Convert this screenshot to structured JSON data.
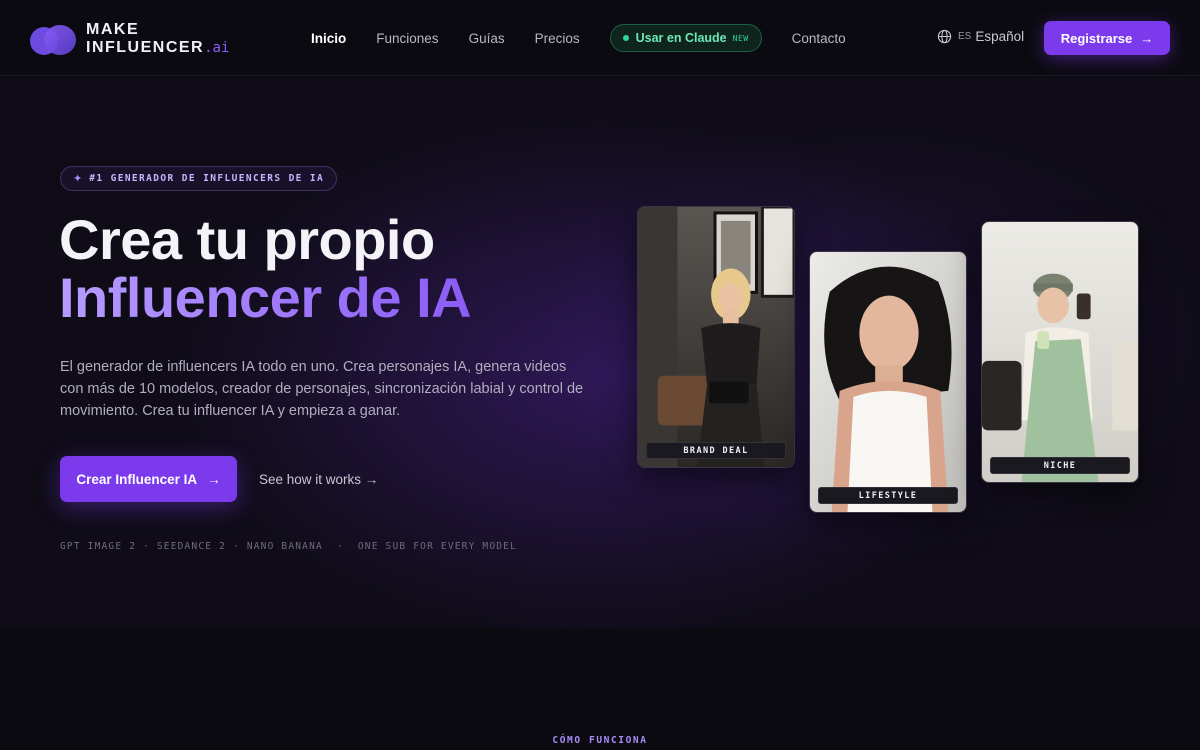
{
  "brand": {
    "line1": "MAKE",
    "line2": "INFLUENCER",
    "suffix": ".ai"
  },
  "nav": {
    "links": [
      "Inicio",
      "Funciones",
      "Guías",
      "Precios"
    ],
    "claude": {
      "label": "Usar en Claude",
      "badge": "NEW"
    },
    "contact": "Contacto",
    "lang_code": "ES",
    "lang_label": "Español",
    "register": "Registrarse"
  },
  "hero": {
    "badge": "#1 GENERADOR DE INFLUENCERS DE IA",
    "title_line1": "Crea tu propio",
    "title_line2": "Influencer de IA",
    "description": "El generador de influencers IA todo en uno. Crea personajes IA, genera videos con más de 10 modelos, creador de personajes, sincronización labial y control de movimiento. Crea tu influencer IA y empieza a ganar.",
    "cta_primary": "Crear Influencer IA",
    "cta_secondary": "See how it works →",
    "models_line": "GPT IMAGE 2 · SEEDANCE 2 · NANO BANANA",
    "models_tail": "ONE SUB FOR EVERY MODEL",
    "cards": [
      {
        "tag": "BRAND DEAL"
      },
      {
        "tag": "LIFESTYLE"
      },
      {
        "tag": "NICHE"
      }
    ]
  },
  "next_section": {
    "eyebrow": "CÓMO FUNCIONA"
  },
  "colors": {
    "accent": "#7c3aed",
    "accent_light": "#a78bfa",
    "success": "#34d399",
    "background": "#0b0a10"
  },
  "icons": [
    "globe-icon",
    "arrow-right-icon",
    "sparkle-icon",
    "status-dot-icon"
  ]
}
